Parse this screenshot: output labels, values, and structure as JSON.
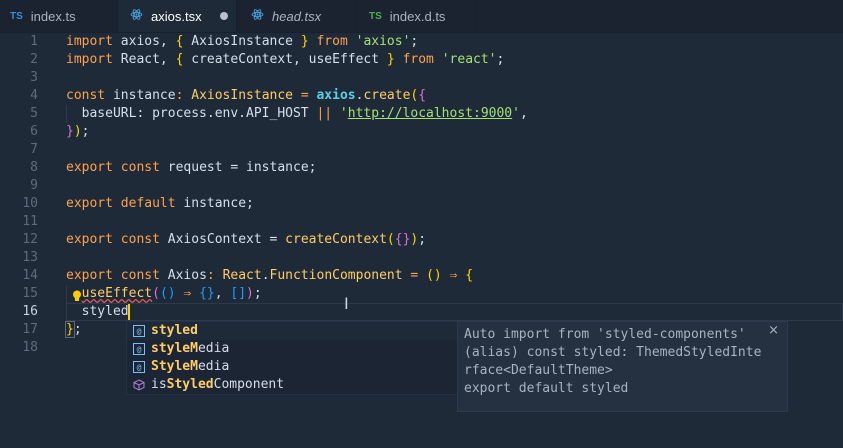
{
  "tabs": [
    {
      "icon": "TS",
      "label": "index.ts",
      "active": false
    },
    {
      "icon": "react",
      "label": "axios.tsx",
      "active": true,
      "dirty": true
    },
    {
      "icon": "react",
      "label": "head.tsx",
      "active": false,
      "italic": true
    },
    {
      "icon": "TS",
      "label": "index.d.ts",
      "active": false
    }
  ],
  "line_numbers": [
    "1",
    "2",
    "3",
    "4",
    "5",
    "6",
    "7",
    "8",
    "9",
    "10",
    "11",
    "12",
    "13",
    "14",
    "15",
    "16",
    "17",
    "18"
  ],
  "code": {
    "l1": {
      "a": "import",
      "b": " axios, ",
      "c": "{",
      "d": " AxiosInstance ",
      "e": "}",
      "f": " from ",
      "g": "'axios'",
      "h": ";"
    },
    "l2": {
      "a": "import",
      "b": " React, ",
      "c": "{",
      "d": " createContext, useEffect ",
      "e": "}",
      "f": " from ",
      "g": "'react'",
      "h": ";"
    },
    "l4": {
      "a": "const",
      "b": " instance",
      "c": ": ",
      "d": "AxiosInstance",
      "e": " = ",
      "f": "axios",
      "g": ".",
      "h": "create",
      "i": "(",
      "j": "{"
    },
    "l5": {
      "a": "  baseURL: process.env.API_HOST ",
      "b": "||",
      "c": " '",
      "d": "http://localhost:9000",
      "e": "'",
      "f": ","
    },
    "l6": {
      "a": "}",
      "b": ")",
      "c": ";"
    },
    "l8": {
      "a": "export",
      "b": " ",
      "c": "const",
      "d": " request = instance;"
    },
    "l10": {
      "a": "export",
      "b": " ",
      "c": "default",
      "d": " instance;"
    },
    "l12": {
      "a": "export",
      "b": " ",
      "c": "const",
      "d": " AxiosContext = ",
      "e": "createContext",
      "f": "(",
      "g": "{}",
      "h": ")",
      "i": ";"
    },
    "l14": {
      "a": "export",
      "b": " ",
      "c": "const",
      "d": " Axios",
      "e": ": ",
      "f": "React",
      "g": ".",
      "h": "FunctionComponent",
      "i": " = ",
      "j": "()",
      "k": " ⇒ ",
      "l": "{"
    },
    "l15": {
      "a": "  ",
      "b": "useEffect",
      "c": "(",
      "d": "()",
      "e": " ⇒ ",
      "f": "{}",
      "g": ", ",
      "h": "[]",
      "i": ")",
      "j": ";"
    },
    "l16": {
      "a": "  styled"
    },
    "l17": {
      "a": "}",
      "b": ";"
    }
  },
  "suggestions": [
    {
      "icon": "variable-icon",
      "match": "styled",
      "rest": "",
      "prefix": ""
    },
    {
      "icon": "variable-icon",
      "prefix": "",
      "match": "styleM",
      "rest": "edia",
      "pre_extra": ""
    },
    {
      "icon": "variable-icon",
      "prefix": "",
      "match": "StyleM",
      "rest": "edia"
    },
    {
      "icon": "cube-icon",
      "prefix": "is",
      "match": "Styled",
      "rest": "Component"
    }
  ],
  "details": {
    "line1": "Auto import from 'styled-components'",
    "line2": "(alias) const styled: ThemedStyledInte",
    "line3": "rface<DefaultTheme>",
    "line4": "export default styled",
    "close": "×"
  },
  "colors": {
    "background": "#1e2a38",
    "keyword": "#ffa14e",
    "string": "#a5e075",
    "type": "#ffcc66",
    "cursor": "#ffcc00"
  }
}
